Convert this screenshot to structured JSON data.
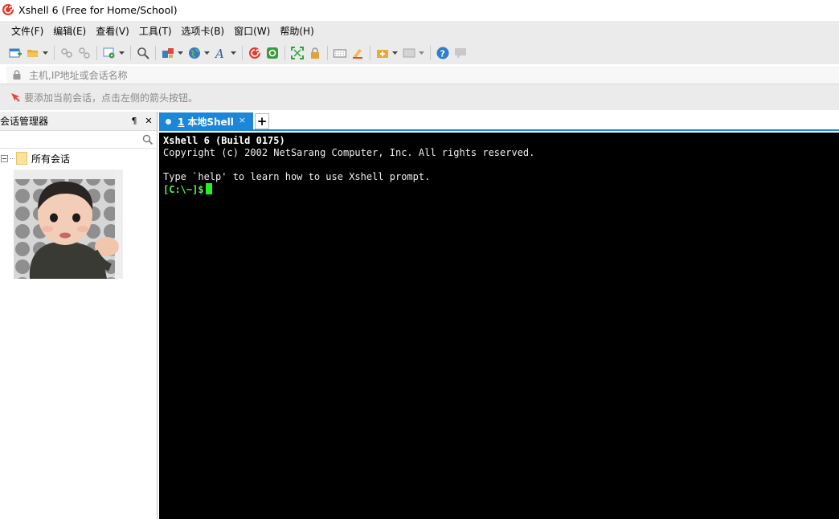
{
  "window": {
    "title": "Xshell 6 (Free for Home/School)",
    "app_icon": "xshell-logo-icon"
  },
  "menu": {
    "items": [
      "文件(F)",
      "编辑(E)",
      "查看(V)",
      "工具(T)",
      "选项卡(B)",
      "窗口(W)",
      "帮助(H)"
    ]
  },
  "toolbar": {
    "buttons": [
      "new-session-icon",
      "open-folder-icon",
      "connect-icon",
      "disconnect-icon",
      "properties-icon",
      "find-icon",
      "transfer-icon",
      "globe-icon",
      "font-icon",
      "xshell-icon",
      "xftp-icon",
      "fullscreen-icon",
      "lock-icon",
      "keyboard-icon",
      "highlight-icon",
      "add-tab-icon",
      "layout-icon",
      "help-icon",
      "chat-icon"
    ]
  },
  "address": {
    "placeholder": "主机,IP地址或会话名称"
  },
  "hint": {
    "text": "要添加当前会话，点击左侧的箭头按钮。"
  },
  "session_manager": {
    "title": "会话管理器",
    "pin": "¶",
    "close": "✕",
    "tree_root": "所有会话"
  },
  "tabs": {
    "active": {
      "number": "1",
      "label": "本地Shell",
      "close": "×"
    },
    "new_tab": "+"
  },
  "terminal": {
    "line1": "Xshell 6 (Build 0175)",
    "line2": "Copyright (c) 2002 NetSarang Computer, Inc. All rights reserved.",
    "line3": "",
    "line4": "Type `help' to learn how to use Xshell prompt.",
    "prompt": "[C:\\~]$"
  },
  "colors": {
    "accent": "#1c86d9",
    "terminal_bg": "#000000",
    "prompt": "#5af05a"
  }
}
